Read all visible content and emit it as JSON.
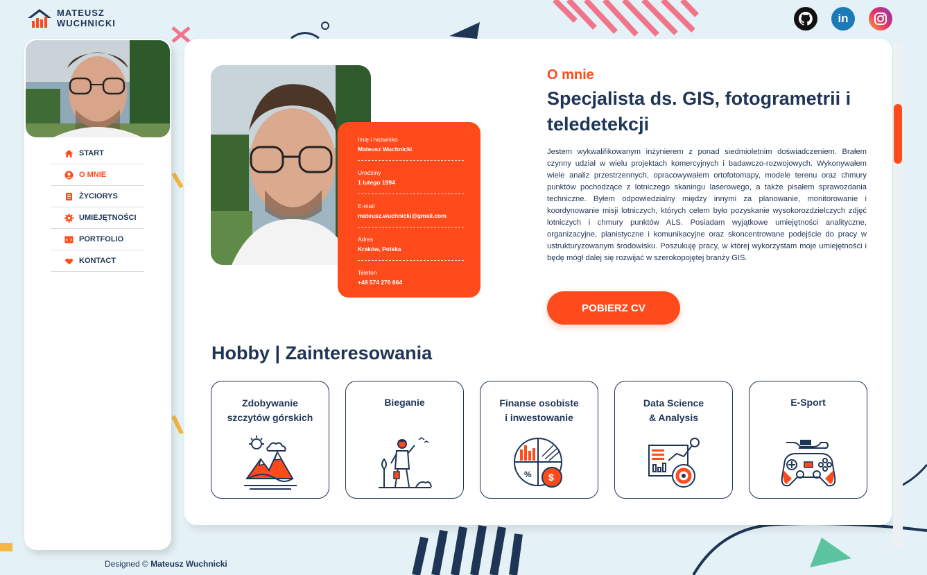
{
  "brand": {
    "line1": "MATEUSZ",
    "line2": "WUCHNICKI"
  },
  "social": [
    {
      "name": "github-icon"
    },
    {
      "name": "linkedin-icon"
    },
    {
      "name": "instagram-icon"
    }
  ],
  "nav": {
    "items": [
      {
        "label": "START",
        "icon": "home-icon",
        "active": false
      },
      {
        "label": "O MNIE",
        "icon": "user-icon",
        "active": true
      },
      {
        "label": "ŻYCIORYS",
        "icon": "document-icon",
        "active": false
      },
      {
        "label": "UMIEJĘTNOŚCI",
        "icon": "gear-icon",
        "active": false
      },
      {
        "label": "PORTFOLIO",
        "icon": "code-icon",
        "active": false
      },
      {
        "label": "KONTACT",
        "icon": "handshake-icon",
        "active": false
      }
    ]
  },
  "info": {
    "name_label": "Imię i nazwisko",
    "name_value": "Mateusz Wuchnicki",
    "birth_label": "Urodziny",
    "birth_value": "1 lutego 1994",
    "email_label": "E-mail",
    "email_value": "mateusz.wuchnicki@gmail.com",
    "address_label": "Adres",
    "address_value": "Kraków, Polska",
    "phone_label": "Telefon",
    "phone_value": "+48 574 270 864"
  },
  "about": {
    "kicker": "O mnie",
    "title": "Specjalista ds. GIS, fotogrametrii i teledetekcji",
    "text": "Jestem wykwalifikowanym inżynierem z ponad siedmioletnim doświadczeniem. Brałem czynny udział w wielu projektach komercyjnych i badawczo-rozwojowych. Wykonywałem wiele analiz przestrzennych, opracowywałem ortofotomapy, modele terenu oraz chmury punktów pochodzące z lotniczego skaningu laserowego, a także pisałem sprawozdania techniczne. Byłem odpowiedzialny między innymi za planowanie, monitorowanie i koordynowanie misji lotniczych, których celem było pozyskanie wysokorozdzielczych zdjęć lotniczych i chmury punktów ALS. Posiadam wyjątkowe umiejętności analityczne, organizacyjne, planistyczne i komunikacyjne oraz skoncentrowane podejście do pracy w ustrukturyzowanym środowisku. Poszukuję pracy, w której wykorzystam moje umiejętności i będę mógł dalej się rozwijać w szerokopojętej branży GIS.",
    "cv_button": "POBIERZ CV"
  },
  "hobbies": {
    "title": "Hobby | Zainteresowania",
    "items": [
      {
        "line1": "Zdobywanie",
        "line2": "szczytów górskich",
        "icon": "mountains-icon"
      },
      {
        "line1": "Bieganie",
        "line2": "",
        "icon": "runner-icon"
      },
      {
        "line1": "Finanse osobiste",
        "line2": "i inwestowanie",
        "icon": "finance-chart-icon"
      },
      {
        "line1": "Data Science",
        "line2": "& Analysis",
        "icon": "data-analysis-icon"
      },
      {
        "line1": "E-Sport",
        "line2": "",
        "icon": "gamepad-icon"
      }
    ]
  },
  "footer": {
    "prefix": "Designed ©",
    "author": "Mateusz Wuchnicki"
  },
  "colors": {
    "accent": "#ff4a1c",
    "navy": "#1f3556",
    "background": "#e4f1f6"
  }
}
